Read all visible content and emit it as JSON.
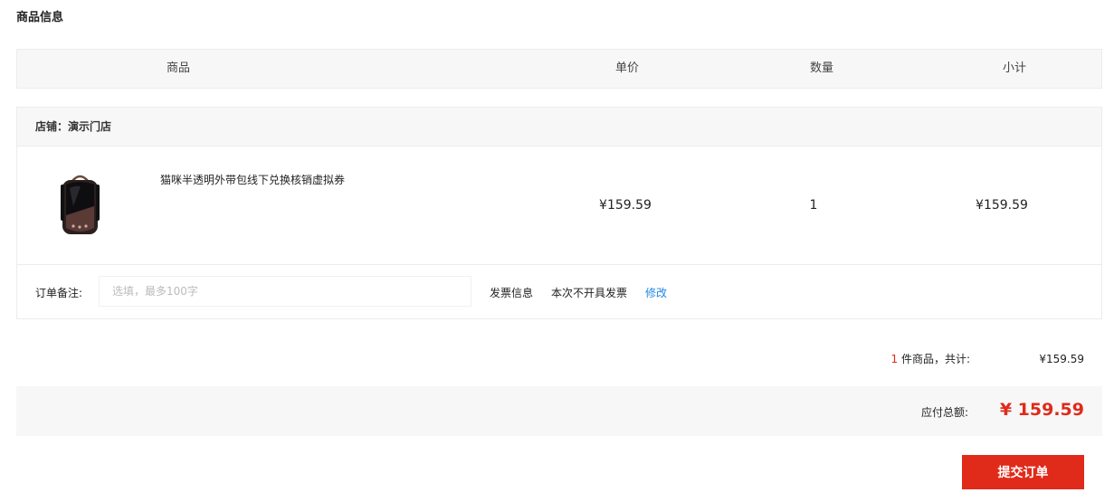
{
  "section_title": "商品信息",
  "table_header": {
    "product": "商品",
    "unit_price": "单价",
    "quantity": "数量",
    "subtotal": "小计"
  },
  "shop": {
    "label": "店铺：",
    "name": "演示门店"
  },
  "item": {
    "name": "猫咪半透明外带包线下兑换核销虚拟券",
    "unit_price": "¥159.59",
    "quantity": "1",
    "subtotal": "¥159.59",
    "thumbnail_icon": "pet-backpack-image"
  },
  "remark": {
    "label": "订单备注:",
    "placeholder": "选填，最多100字",
    "value": ""
  },
  "invoice": {
    "label": "发票信息",
    "value": "本次不开具发票",
    "edit_label": "修改"
  },
  "summary": {
    "count": "1",
    "count_suffix": " 件商品，共计:",
    "amount": "¥159.59"
  },
  "total": {
    "label": "应付总额:",
    "value": "¥ 159.59"
  },
  "submit_label": "提交订单",
  "colors": {
    "accent": "#e02a1a",
    "link": "#1e88e5",
    "header_bg": "#f7f7f7"
  }
}
